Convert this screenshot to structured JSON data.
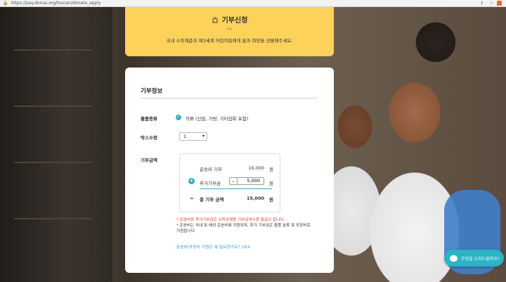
{
  "browser": {
    "url": "https://pay.donus.org/toscan/donate_apply",
    "extension_badge": "EX"
  },
  "banner": {
    "title": "기부신청",
    "wave": "〰",
    "subtitle": "국내 소외계층과 제3세계 어린이들에게 꿈과 희망을 선물해주세요."
  },
  "form": {
    "section_title": "기부정보",
    "item_type_label": "물품종류",
    "item_type_value": "의류 (신발, 가방, 기타잡화 포함)",
    "box_count_label": "박스수량",
    "box_count_value": "1",
    "amount_label": "기부금액",
    "shipping_label": "운송비 기부",
    "shipping_amount": "10,000",
    "won": "원",
    "extra_label": "추가기부금",
    "extra_amount": "5,000",
    "equals": "=",
    "total_label": "총 기부 금액",
    "total_amount": "15,000",
    "note_red": "* 운송비와 추가기부금은 소득공제용 기부금영수증 발급이 됩니다.",
    "note_1": "* 운송비는 국내 및 해외 운송비에 지원되며, 추가 기부금은 물품 분류 및 포장비로",
    "note_2": "지원됩니다.",
    "link_text": "운송비/포장비 지원은 왜 필요한가요? click"
  },
  "chat": {
    "label": "무엇을 도와드릴까요?"
  },
  "colors": {
    "banner_yellow": "#fdd25a",
    "accent_teal": "#3aa9c6",
    "warning_red": "#e0302d"
  }
}
